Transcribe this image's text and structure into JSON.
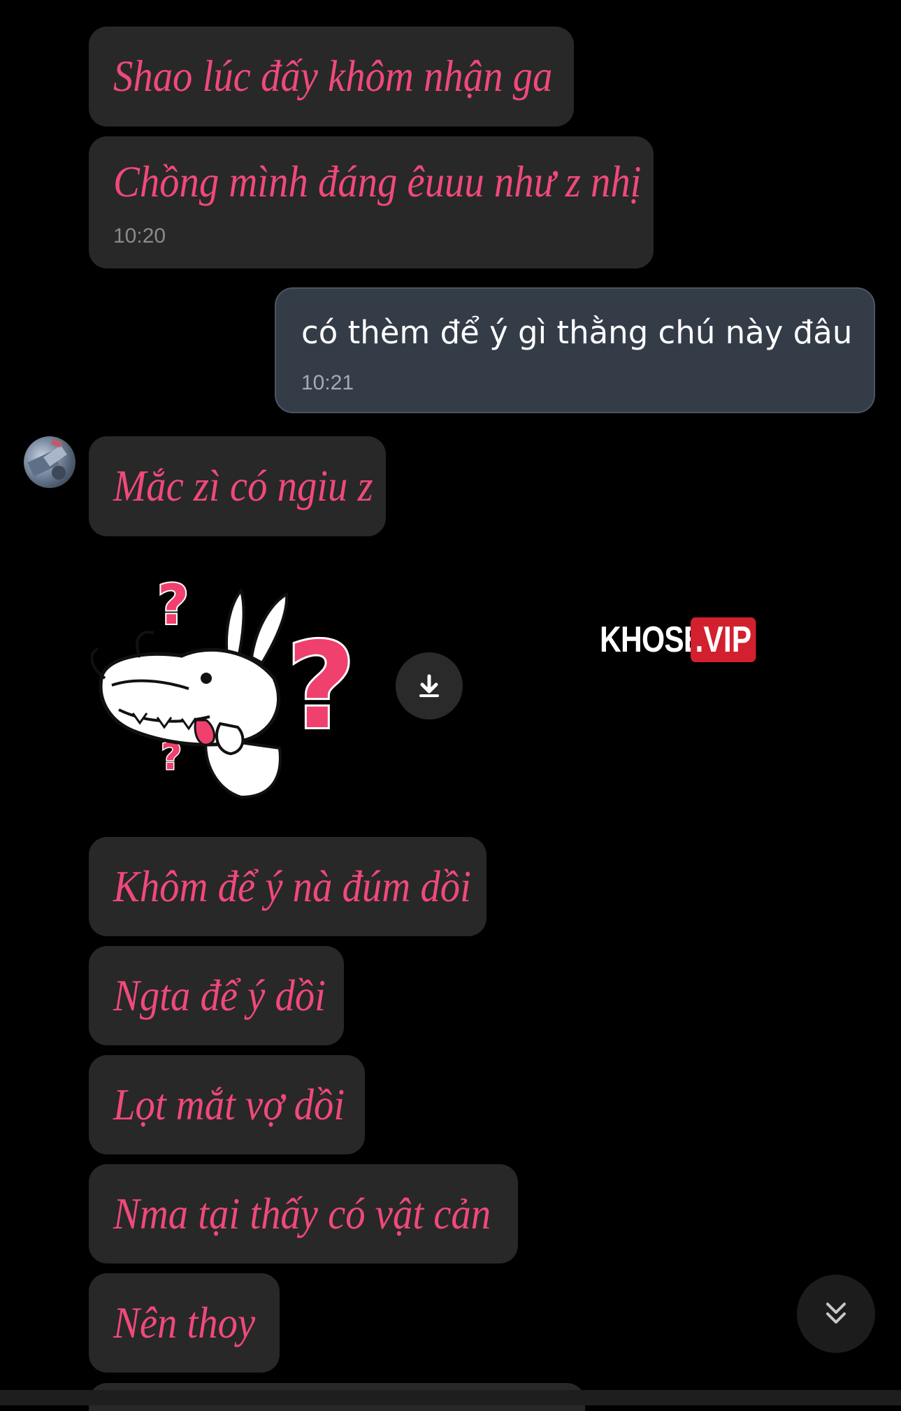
{
  "messages": [
    {
      "text": "Shao lúc đấy khôm nhận ga"
    },
    {
      "text": "Chồng mình đáng êuuu như z nhị",
      "time": "10:20"
    },
    {
      "text": "có thèm để ý gì thằng chú này đâu",
      "time": "10:21"
    },
    {
      "text": "Mắc zì có ngiu z"
    },
    {
      "text": "Khôm để ý nà đúm dồi"
    },
    {
      "text": "Ngta để ý dồi"
    },
    {
      "text": "Lọt mắt vợ dồi"
    },
    {
      "text": "Nma tại thấy có vật cản"
    },
    {
      "text": "Nên thoy"
    }
  ],
  "sticker": {
    "icon": "dragon-question-sticker",
    "glyph": "?"
  },
  "watermark": {
    "part1": "KHOSEX",
    "part2": ".VIP"
  },
  "icons": {
    "download": "download-icon",
    "scroll_down": "double-chevron-down-icon"
  },
  "colors": {
    "background": "#000000",
    "incoming_bubble": "#282828",
    "incoming_text": "#f0497a",
    "outgoing_bubble": "#343c48",
    "outgoing_text": "#ffffff",
    "timestamp": "#8a8a8e"
  }
}
